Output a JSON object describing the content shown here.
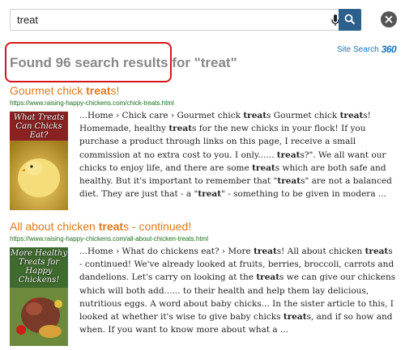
{
  "search": {
    "value": "treat"
  },
  "brand": {
    "label": "Site Search",
    "mark": "360"
  },
  "results_header": "Found 96 search results for \"treat\"",
  "results": [
    {
      "title_parts": [
        "Gourmet chick ",
        "treat",
        "s!"
      ],
      "url": "https://www.raising-happy-chickens.com/chick-treats.html",
      "thumb_caption": "What Treats Can Chicks Eat?",
      "snippet_parts": [
        "...Home  › Chick care  › Gourmet chick ",
        "treat",
        "s Gourmet chick ",
        "treat",
        "s! Homemade, healthy ",
        "treat",
        "s for the new chicks in your flock! If you purchase a product through links on this page, I receive a small commission at no extra cost to you.  I only...... ",
        "treat",
        "s?\". We all want our chicks to enjoy life, and there are some ",
        "treat",
        "s which are both safe and healthy.  But it's important to remember that \"",
        "treat",
        "s\" are not a balanced diet. They are just that - a \"",
        "treat",
        "\" - something to be given in modera ..."
      ]
    },
    {
      "title_parts": [
        "All about chicken ",
        "treat",
        "s - continued!"
      ],
      "url": "https://www.raising-happy-chickens.com/all-about-chicken-treats.html",
      "thumb_caption": "More Healthy Treats for Happy Chickens!",
      "snippet_parts": [
        "...Home  › What do chickens eat?  › More ",
        "treat",
        "s! All about chicken ",
        "treat",
        "s - continued! We've already looked at fruits, berries, broccoli, carrots and dandelions. Let's carry on looking at the ",
        "treat",
        "s we can give our chickens which will both add...... to their health and help them lay delicious, nutritious eggs. A word about baby chicks... In the sister article to this, I looked at whether it's wise to give baby chicks ",
        "treat",
        "s, and if so how and when. If you want to know more about what a ..."
      ]
    }
  ],
  "colors": {
    "title": "#e07a1a",
    "url": "#1a6e1a",
    "accent": "#2c5f8a",
    "highlight": "#d8151b",
    "brand": "#1a73b8"
  },
  "icons": [
    "microphone-icon",
    "search-icon",
    "close-icon"
  ]
}
